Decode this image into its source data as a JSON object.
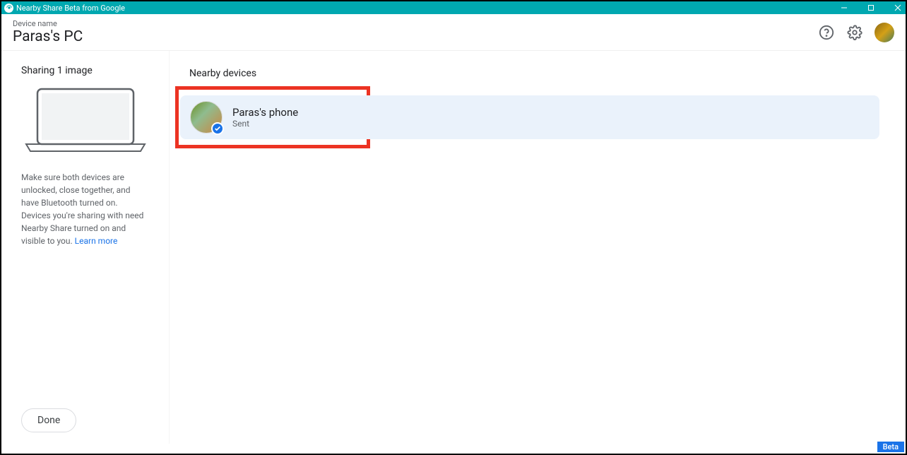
{
  "window": {
    "title": "Nearby Share Beta from Google"
  },
  "header": {
    "device_label": "Device name",
    "device_name": "Paras's PC"
  },
  "sidebar": {
    "sharing_title": "Sharing 1 image",
    "help_text": "Make sure both devices are unlocked, close together, and have Bluetooth turned on. Devices you're sharing with need Nearby Share turned on and visible to you. ",
    "learn_more": "Learn more",
    "done_label": "Done"
  },
  "main": {
    "section_title": "Nearby devices",
    "devices": [
      {
        "name": "Paras's phone",
        "status": "Sent"
      }
    ]
  },
  "footer": {
    "beta_label": "Beta"
  }
}
